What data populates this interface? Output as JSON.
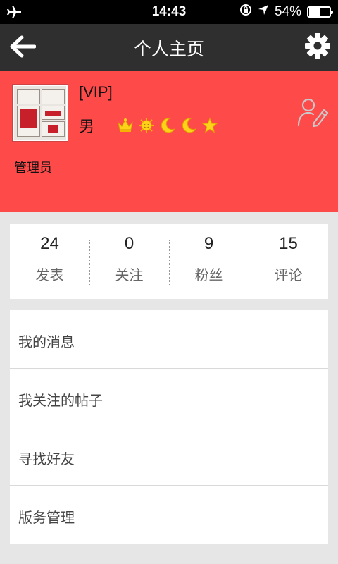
{
  "status_bar": {
    "time": "14:43",
    "battery_percent": "54%",
    "battery_level": 0.54,
    "icons": [
      "airplane-icon",
      "rotation-lock-icon",
      "location-arrow-icon",
      "battery-icon"
    ]
  },
  "header": {
    "title": "个人主页",
    "back_icon": "arrow-left-icon",
    "settings_icon": "gear-icon"
  },
  "profile": {
    "vip_label": "[VIP]",
    "gender": "男",
    "role": "管理员",
    "badges": [
      "crown-icon",
      "sun-icon",
      "moon-icon",
      "moon-icon",
      "star-icon"
    ],
    "edit_icon": "edit-profile-icon",
    "background_color": "#ff4a4a"
  },
  "stats": [
    {
      "value": "24",
      "label": "发表"
    },
    {
      "value": "0",
      "label": "关注"
    },
    {
      "value": "9",
      "label": "粉丝"
    },
    {
      "value": "15",
      "label": "评论"
    }
  ],
  "menu": {
    "items": [
      {
        "label": "我的消息"
      },
      {
        "label": "我关注的帖子"
      },
      {
        "label": "寻找好友"
      },
      {
        "label": "版务管理"
      }
    ]
  }
}
